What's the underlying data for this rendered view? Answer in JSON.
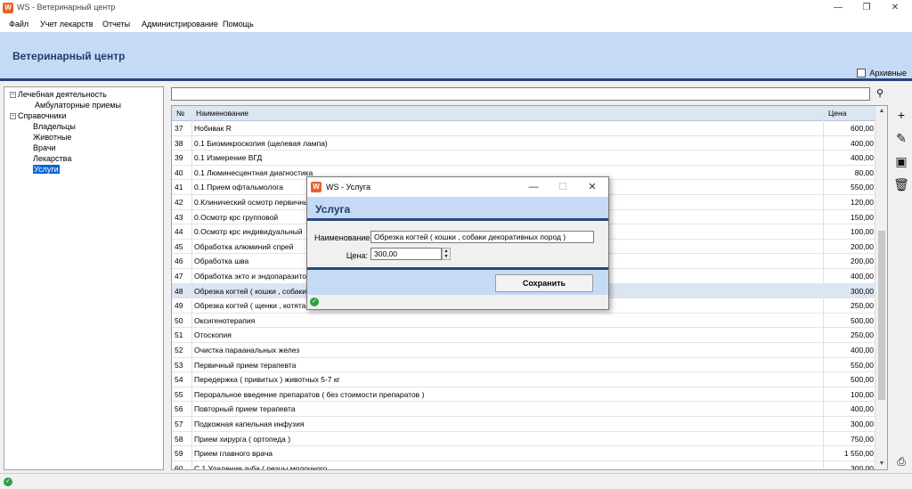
{
  "window": {
    "title": "WS - Ветеринарный центр",
    "minimize_icon": "minimize-icon",
    "restore_icon": "restore-icon",
    "close_icon": "close-icon"
  },
  "menu": [
    "Файл",
    "Учет лекарств",
    "Отчеты",
    "Администрирование",
    "Помощь"
  ],
  "header": {
    "title": "Ветеринарный центр",
    "archive_label": "Архивные"
  },
  "tree": [
    {
      "label": "Лечебная деятельность",
      "level": 0,
      "expander": "−"
    },
    {
      "label": "Амбулаторные приемы",
      "level": 1
    },
    {
      "label": "Справочники",
      "level": 0,
      "expander": "−"
    },
    {
      "label": "Владельцы",
      "level": 1
    },
    {
      "label": "Животные",
      "level": 1
    },
    {
      "label": "Врачи",
      "level": 1
    },
    {
      "label": "Лекарства",
      "level": 1
    },
    {
      "label": "Услуги",
      "level": 1,
      "selected": true
    }
  ],
  "search": {
    "value": ""
  },
  "grid": {
    "columns": [
      "№",
      "Наименование",
      "Цена"
    ],
    "rows": [
      {
        "no": "37",
        "name": "Нобивак  R",
        "price": "600,00"
      },
      {
        "no": "38",
        "name": "0.1 Биомикроскопия (щелевая лампа)",
        "price": "400,00"
      },
      {
        "no": "39",
        "name": "0.1 Измерение ВГД",
        "price": "400,00"
      },
      {
        "no": "40",
        "name": "0.1 Люминесцентная диагностика",
        "price": "80,00"
      },
      {
        "no": "41",
        "name": "0.1 Прием офтальмолога",
        "price": "550,00"
      },
      {
        "no": "42",
        "name": "0.Клинический осмотр первичный",
        "price": "120,00"
      },
      {
        "no": "43",
        "name": "0.Осмотр крс групповой",
        "price": "150,00"
      },
      {
        "no": "44",
        "name": "0.Осмотр крс индивидуальный",
        "price": "100,00"
      },
      {
        "no": "45",
        "name": "Обработка  алюминий спрей",
        "price": "200,00"
      },
      {
        "no": "46",
        "name": "Обработка шва",
        "price": "200,00"
      },
      {
        "no": "47",
        "name": "Обработка экто и эндопаразитов",
        "price": "400,00"
      },
      {
        "no": "48",
        "name": "Обрезка когтей ( кошки , собаки",
        "price": "300,00",
        "selected": true
      },
      {
        "no": "49",
        "name": "Обрезка когтей ( щенки , котята",
        "price": "250,00"
      },
      {
        "no": "50",
        "name": "Оксигенотерапия",
        "price": "500,00"
      },
      {
        "no": "51",
        "name": "Отоскопия",
        "price": "250,00"
      },
      {
        "no": "52",
        "name": "Очистка параанальных желез",
        "price": "400,00"
      },
      {
        "no": "53",
        "name": "Первичный прием  терапевта",
        "price": "550,00"
      },
      {
        "no": "54",
        "name": "Передержка  ( привитых ) животных 5-7 кг",
        "price": "500,00"
      },
      {
        "no": "55",
        "name": "Пероральное введение  препаратов  ( без стоимости препаратов )",
        "price": "100,00"
      },
      {
        "no": "56",
        "name": "Повторный прием терапевта",
        "price": "400,00"
      },
      {
        "no": "57",
        "name": "Подкожная капельная инфузия",
        "price": "300,00"
      },
      {
        "no": "58",
        "name": "Прием  хирурга  ( ортопеда )",
        "price": "750,00"
      },
      {
        "no": "59",
        "name": "Прием главного врача",
        "price": "1 550,00"
      },
      {
        "no": "60",
        "name": "С.1 Удаление зуба ( резцы молочного",
        "price": "300,00"
      }
    ]
  },
  "toolbar": [
    {
      "name": "add-button",
      "icon": "+",
      "icon_name": "plus-icon"
    },
    {
      "name": "edit-button",
      "icon": "✎",
      "icon_name": "pencil-icon"
    },
    {
      "name": "archive-button",
      "icon": "▣",
      "icon_name": "archive-box-icon"
    },
    {
      "name": "delete-button",
      "icon": "🗑",
      "icon_name": "trash-icon"
    }
  ],
  "print_icon": "printer-icon",
  "dialog": {
    "title": "WS - Услуга",
    "header": "Услуга",
    "name_label": "Наименование:",
    "name_value": "Обрезка когтей  ( кошки , собаки декоративных пород )",
    "price_label": "Цена:",
    "price_value": "300,00",
    "save_label": "Сохранить"
  }
}
